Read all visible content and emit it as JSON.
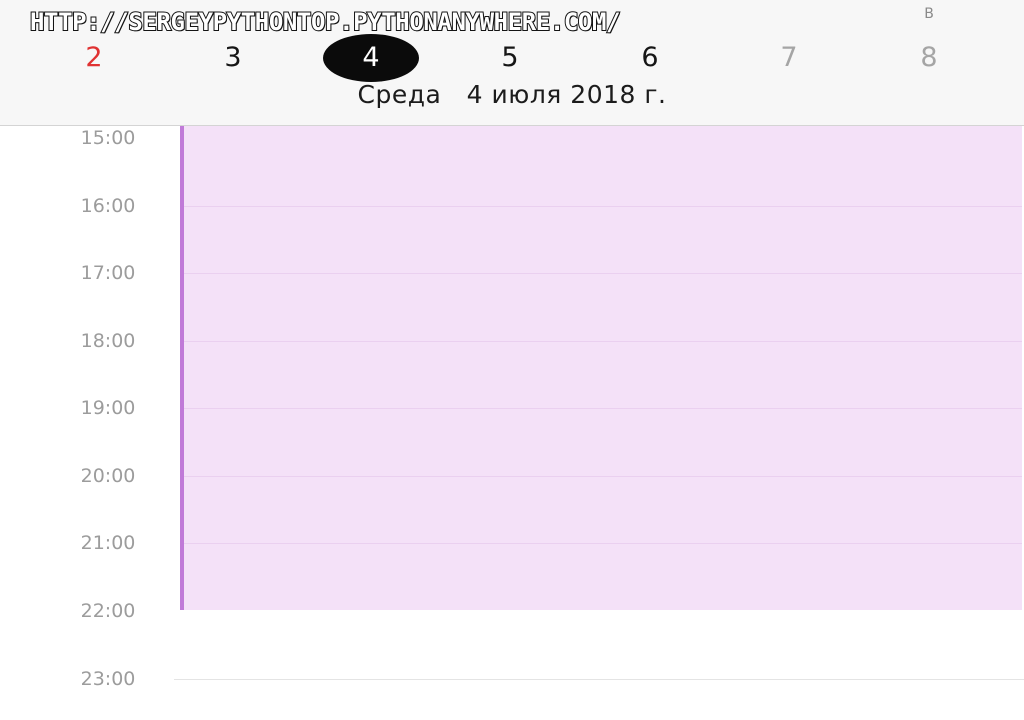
{
  "watermark": "HTTP://SERGEYPYTHONTOP.PYTHONANYWHERE.COM/",
  "week": {
    "labels": [
      "",
      "",
      "",
      "",
      "",
      "",
      "В"
    ],
    "days": [
      {
        "num": "2",
        "state": "sunday"
      },
      {
        "num": "3",
        "state": "normal"
      },
      {
        "num": "4",
        "state": "selected"
      },
      {
        "num": "5",
        "state": "normal"
      },
      {
        "num": "6",
        "state": "normal"
      },
      {
        "num": "7",
        "state": "weekend"
      },
      {
        "num": "8",
        "state": "weekend"
      }
    ]
  },
  "selected_date": "Среда   4 июля 2018 г.",
  "timeline": {
    "hours": [
      "15:00",
      "16:00",
      "17:00",
      "18:00",
      "19:00",
      "20:00",
      "21:00",
      "22:00",
      "23:00"
    ],
    "event": {
      "start": "15:00",
      "end": "22:00"
    }
  },
  "colors": {
    "sunday": "#e03232",
    "weekend": "#a5a5a5",
    "selected_bg": "#0b0b0b",
    "event_fill": "#f4e1f8",
    "event_bar": "#c07ad8"
  }
}
